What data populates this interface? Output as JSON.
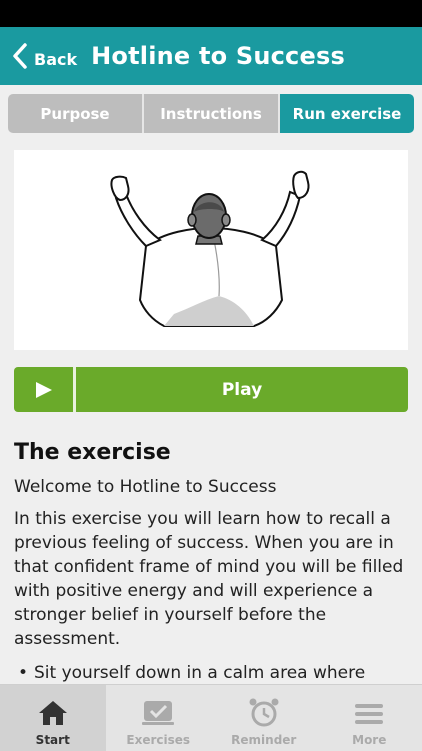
{
  "nav": {
    "back_label": "Back",
    "title": "Hotline to Success"
  },
  "tabs": [
    {
      "label": "Purpose",
      "active": false
    },
    {
      "label": "Instructions",
      "active": false
    },
    {
      "label": "Run exercise",
      "active": true
    }
  ],
  "player": {
    "play_label": "Play"
  },
  "content": {
    "heading": "The exercise",
    "subtitle": "Welcome to Hotline to Success",
    "paragraph": "In this exercise you will learn how to recall a previous feeling of success. When you are in that confident frame of mind you will be filled with positive energy and will experience a stronger belief in yourself before the assessment.",
    "bullet": "Sit yourself down in a calm area where"
  },
  "tabbar": [
    {
      "label": "Start",
      "icon": "home-icon",
      "active": true
    },
    {
      "label": "Exercises",
      "icon": "exercises-icon",
      "active": false
    },
    {
      "label": "Reminder",
      "icon": "alarm-clock-icon",
      "active": false
    },
    {
      "label": "More",
      "icon": "menu-icon",
      "active": false
    }
  ],
  "colors": {
    "teal": "#1a9aa0",
    "green": "#6aaa2a",
    "tab_inactive": "#bdbdbd"
  }
}
